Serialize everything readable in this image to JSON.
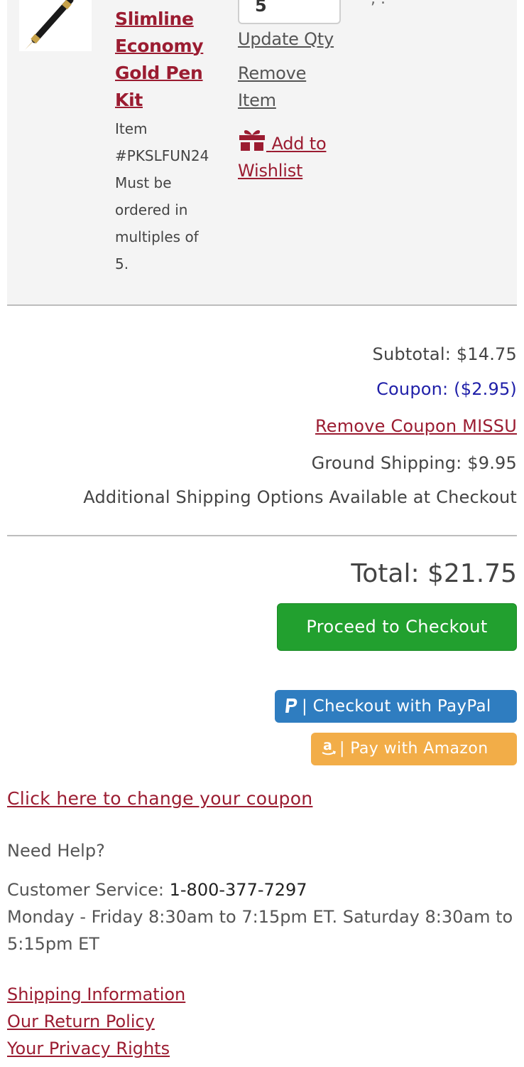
{
  "cart_item": {
    "product_name_lines": [
      "Slimline",
      "Economy",
      "Gold Pen",
      "Kit"
    ],
    "item_label": "Item",
    "item_number": "#PKSLFUN24",
    "note_lines": [
      "Must be",
      "ordered in",
      "multiples of",
      "5."
    ],
    "quantity": "5",
    "update_qty_label": "Update Qty",
    "remove_label_lines": [
      "Remove",
      "Item"
    ],
    "wishlist_label_lines": [
      "Add to",
      "Wishlist"
    ],
    "top_hint": ", ."
  },
  "summary": {
    "subtotal": "Subtotal: $14.75",
    "coupon": "Coupon: ($2.95)",
    "remove_coupon": "Remove Coupon MISSU",
    "shipping": "Ground Shipping: $9.95",
    "shipping_note": "Additional Shipping Options Available at Checkout",
    "total": "Total: $21.75"
  },
  "actions": {
    "checkout": "Proceed to Checkout",
    "paypal": "| Checkout with PayPal",
    "amazon": "| Pay with Amazon"
  },
  "coupon_link": "Click here to change your coupon",
  "help": {
    "title": "Need Help?",
    "service_label": "Customer Service: ",
    "phone": "1-800-377-7297",
    "hours": "Monday - Friday 8:30am to 7:15pm ET. Saturday 8:30am to 5:15pm ET"
  },
  "footer_links": [
    "Shipping Information",
    "Our Return Policy",
    "Your Privacy Rights"
  ],
  "colors": {
    "brand": "#9b1c31",
    "coupon": "#1f1fa8",
    "checkout_button": "#22a02f",
    "paypal_button": "#2f7dc0",
    "amazon_button": "#f2ad48"
  },
  "icons": [
    "pen-image",
    "gift-icon",
    "paypal-icon",
    "amazon-icon"
  ]
}
